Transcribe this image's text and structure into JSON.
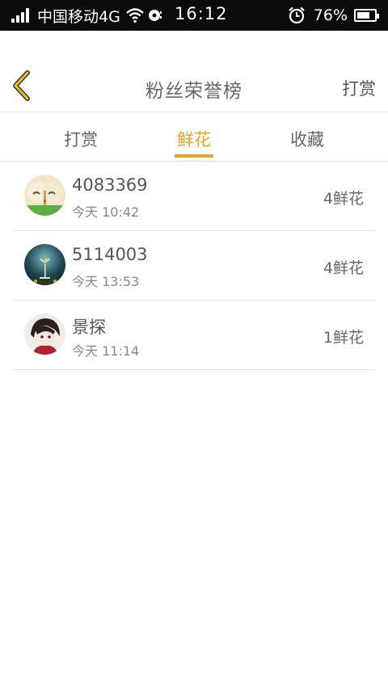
{
  "status_bar": {
    "carrier": "中国移动4G",
    "time": "16:12",
    "battery_percent": "76%",
    "battery_level": 0.76
  },
  "header": {
    "title": "粉丝荣誉榜",
    "action": "打赏"
  },
  "tabs": [
    {
      "label": "打赏",
      "active": false
    },
    {
      "label": "鲜花",
      "active": true
    },
    {
      "label": "收藏",
      "active": false
    }
  ],
  "list": [
    {
      "name": "4083369",
      "time": "今天 10:42",
      "count": "4鲜花"
    },
    {
      "name": "5114003",
      "time": "今天 13:53",
      "count": "4鲜花"
    },
    {
      "name": "景探",
      "time": "今天 11:14",
      "count": "1鲜花"
    }
  ],
  "colors": {
    "accent": "#f0a020",
    "back_arrow": "#e8c020"
  }
}
